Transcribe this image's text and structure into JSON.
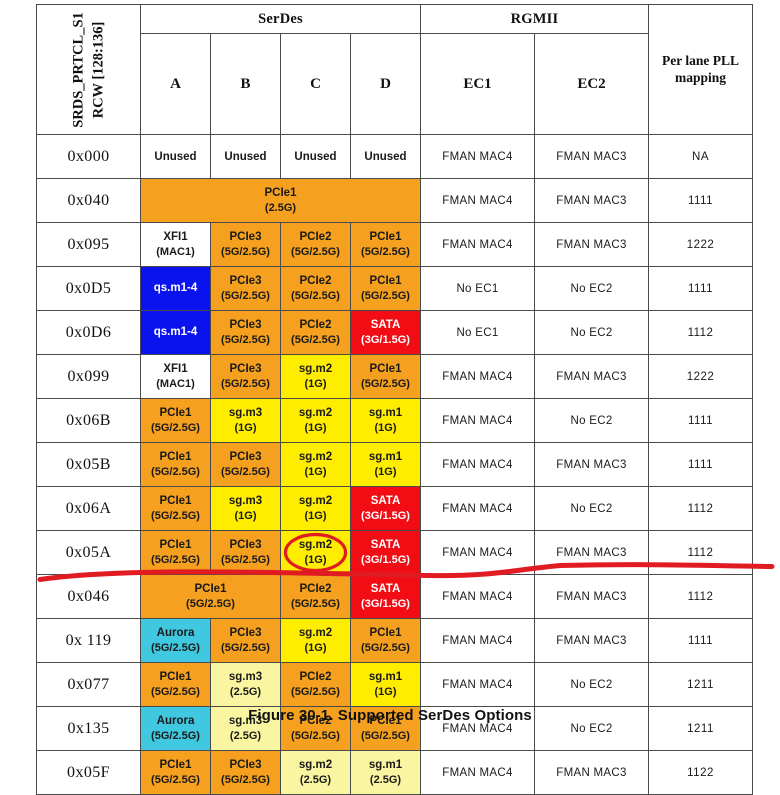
{
  "figure": {
    "caption": "Figure 30-1. Supported SerDes Options"
  },
  "table": {
    "header": {
      "rcw_label": "SRDS_PRTCL_S1\nRCW [128:136]",
      "rcw_line1": "SRDS_PRTCL_S1",
      "rcw_line2": "RCW [128:136]",
      "serdes_group": "SerDes",
      "rgmii_group": "RGMII",
      "serdes_cols": [
        "A",
        "B",
        "C",
        "D"
      ],
      "rgmii_cols": [
        "EC1",
        "EC2"
      ],
      "pll_line1": "Per lane PLL",
      "pll_line2": "mapping"
    },
    "rows": [
      {
        "code": "0x000",
        "lanes": [
          {
            "name": "Unused",
            "rate": "",
            "fill": "none",
            "span": 1,
            "style": "unused"
          },
          {
            "name": "Unused",
            "rate": "",
            "fill": "none",
            "span": 1,
            "style": "unused"
          },
          {
            "name": "Unused",
            "rate": "",
            "fill": "none",
            "span": 1,
            "style": "unused"
          },
          {
            "name": "Unused",
            "rate": "",
            "fill": "none",
            "span": 1,
            "style": "unused"
          }
        ],
        "ec1": "FMAN MAC4",
        "ec2": "FMAN MAC3",
        "pll": "NA"
      },
      {
        "code": "0x040",
        "lanes": [
          {
            "name": "PCIe1",
            "rate": "(2.5G)",
            "fill": "orange",
            "span": 4,
            "style": "cell"
          }
        ],
        "ec1": "FMAN MAC4",
        "ec2": "FMAN MAC3",
        "pll": "1111"
      },
      {
        "code": "0x095",
        "lanes": [
          {
            "name": "XFI1",
            "rate": "(MAC1)",
            "fill": "none",
            "span": 1,
            "style": "cell"
          },
          {
            "name": "PCIe3",
            "rate": "(5G/2.5G)",
            "fill": "orange",
            "span": 1,
            "style": "cell"
          },
          {
            "name": "PCIe2",
            "rate": "(5G/2.5G)",
            "fill": "orange",
            "span": 1,
            "style": "cell"
          },
          {
            "name": "PCIe1",
            "rate": "(5G/2.5G)",
            "fill": "orange",
            "span": 1,
            "style": "cell"
          }
        ],
        "ec1": "FMAN MAC4",
        "ec2": "FMAN MAC3",
        "pll": "1222"
      },
      {
        "code": "0x0D5",
        "lanes": [
          {
            "name": "qs.m1-4",
            "rate": "",
            "fill": "blue",
            "span": 1,
            "style": "cell"
          },
          {
            "name": "PCIe3",
            "rate": "(5G/2.5G)",
            "fill": "orange",
            "span": 1,
            "style": "cell"
          },
          {
            "name": "PCIe2",
            "rate": "(5G/2.5G)",
            "fill": "orange",
            "span": 1,
            "style": "cell"
          },
          {
            "name": "PCIe1",
            "rate": "(5G/2.5G)",
            "fill": "orange",
            "span": 1,
            "style": "cell"
          }
        ],
        "ec1": "No EC1",
        "ec2": "No EC2",
        "pll": "1111"
      },
      {
        "code": "0x0D6",
        "lanes": [
          {
            "name": "qs.m1-4",
            "rate": "",
            "fill": "blue",
            "span": 1,
            "style": "cell"
          },
          {
            "name": "PCIe3",
            "rate": "(5G/2.5G)",
            "fill": "orange",
            "span": 1,
            "style": "cell"
          },
          {
            "name": "PCIe2",
            "rate": "(5G/2.5G)",
            "fill": "orange",
            "span": 1,
            "style": "cell"
          },
          {
            "name": "SATA",
            "rate": "(3G/1.5G)",
            "fill": "red",
            "span": 1,
            "style": "cell"
          }
        ],
        "ec1": "No EC1",
        "ec2": "No EC2",
        "pll": "1112"
      },
      {
        "code": "0x099",
        "lanes": [
          {
            "name": "XFI1",
            "rate": "(MAC1)",
            "fill": "none",
            "span": 1,
            "style": "cell"
          },
          {
            "name": "PCIe3",
            "rate": "(5G/2.5G)",
            "fill": "orange",
            "span": 1,
            "style": "cell"
          },
          {
            "name": "sg.m2",
            "rate": "(1G)",
            "fill": "yellow",
            "span": 1,
            "style": "cell"
          },
          {
            "name": "PCIe1",
            "rate": "(5G/2.5G)",
            "fill": "orange",
            "span": 1,
            "style": "cell"
          }
        ],
        "ec1": "FMAN MAC4",
        "ec2": "FMAN MAC3",
        "pll": "1222"
      },
      {
        "code": "0x06B",
        "lanes": [
          {
            "name": "PCIe1",
            "rate": "(5G/2.5G)",
            "fill": "orange",
            "span": 1,
            "style": "cell"
          },
          {
            "name": "sg.m3",
            "rate": "(1G)",
            "fill": "yellow",
            "span": 1,
            "style": "cell"
          },
          {
            "name": "sg.m2",
            "rate": "(1G)",
            "fill": "yellow",
            "span": 1,
            "style": "cell"
          },
          {
            "name": "sg.m1",
            "rate": "(1G)",
            "fill": "yellow",
            "span": 1,
            "style": "cell"
          }
        ],
        "ec1": "FMAN MAC4",
        "ec2": "No EC2",
        "pll": "1111"
      },
      {
        "code": "0x05B",
        "lanes": [
          {
            "name": "PCIe1",
            "rate": "(5G/2.5G)",
            "fill": "orange",
            "span": 1,
            "style": "cell"
          },
          {
            "name": "PCIe3",
            "rate": "(5G/2.5G)",
            "fill": "orange",
            "span": 1,
            "style": "cell"
          },
          {
            "name": "sg.m2",
            "rate": "(1G)",
            "fill": "yellow",
            "span": 1,
            "style": "cell"
          },
          {
            "name": "sg.m1",
            "rate": "(1G)",
            "fill": "yellow",
            "span": 1,
            "style": "cell"
          }
        ],
        "ec1": "FMAN MAC4",
        "ec2": "FMAN MAC3",
        "pll": "1111"
      },
      {
        "code": "0x06A",
        "lanes": [
          {
            "name": "PCIe1",
            "rate": "(5G/2.5G)",
            "fill": "orange",
            "span": 1,
            "style": "cell"
          },
          {
            "name": "sg.m3",
            "rate": "(1G)",
            "fill": "yellow",
            "span": 1,
            "style": "cell"
          },
          {
            "name": "sg.m2",
            "rate": "(1G)",
            "fill": "yellow",
            "span": 1,
            "style": "cell"
          },
          {
            "name": "SATA",
            "rate": "(3G/1.5G)",
            "fill": "red",
            "span": 1,
            "style": "cell"
          }
        ],
        "ec1": "FMAN MAC4",
        "ec2": "No EC2",
        "pll": "1112"
      },
      {
        "code": "0x05A",
        "lanes": [
          {
            "name": "PCIe1",
            "rate": "(5G/2.5G)",
            "fill": "orange",
            "span": 1,
            "style": "cell"
          },
          {
            "name": "PCIe3",
            "rate": "(5G/2.5G)",
            "fill": "orange",
            "span": 1,
            "style": "cell"
          },
          {
            "name": "sg.m2",
            "rate": "(1G)",
            "fill": "yellow",
            "span": 1,
            "style": "cell",
            "circled": true
          },
          {
            "name": "SATA",
            "rate": "(3G/1.5G)",
            "fill": "red",
            "span": 1,
            "style": "cell"
          }
        ],
        "ec1": "FMAN MAC4",
        "ec2": "FMAN MAC3",
        "pll": "1112"
      },
      {
        "code": "0x046",
        "lanes": [
          {
            "name": "PCIe1",
            "rate": "(5G/2.5G)",
            "fill": "orange",
            "span": 2,
            "style": "cell"
          },
          {
            "name": "PCIe2",
            "rate": "(5G/2.5G)",
            "fill": "orange",
            "span": 1,
            "style": "cell"
          },
          {
            "name": "SATA",
            "rate": "(3G/1.5G)",
            "fill": "red",
            "span": 1,
            "style": "cell"
          }
        ],
        "ec1": "FMAN MAC4",
        "ec2": "FMAN MAC3",
        "pll": "1112"
      },
      {
        "code": "0x 119",
        "lanes": [
          {
            "name": "Aurora",
            "rate": "(5G/2.5G)",
            "fill": "cyan",
            "span": 1,
            "style": "cell"
          },
          {
            "name": "PCIe3",
            "rate": "(5G/2.5G)",
            "fill": "orange",
            "span": 1,
            "style": "cell"
          },
          {
            "name": "sg.m2",
            "rate": "(1G)",
            "fill": "yellow",
            "span": 1,
            "style": "cell"
          },
          {
            "name": "PCIe1",
            "rate": "(5G/2.5G)",
            "fill": "orange",
            "span": 1,
            "style": "cell"
          }
        ],
        "ec1": "FMAN MAC4",
        "ec2": "FMAN MAC3",
        "pll": "1111"
      },
      {
        "code": "0x077",
        "lanes": [
          {
            "name": "PCIe1",
            "rate": "(5G/2.5G)",
            "fill": "orange",
            "span": 1,
            "style": "cell"
          },
          {
            "name": "sg.m3",
            "rate": "(2.5G)",
            "fill": "lyellow",
            "span": 1,
            "style": "cell"
          },
          {
            "name": "PCIe2",
            "rate": "(5G/2.5G)",
            "fill": "orange",
            "span": 1,
            "style": "cell"
          },
          {
            "name": "sg.m1",
            "rate": "(1G)",
            "fill": "yellow",
            "span": 1,
            "style": "cell"
          }
        ],
        "ec1": "FMAN MAC4",
        "ec2": "No EC2",
        "pll": "1211"
      },
      {
        "code": "0x135",
        "lanes": [
          {
            "name": "Aurora",
            "rate": "(5G/2.5G)",
            "fill": "cyan",
            "span": 1,
            "style": "cell"
          },
          {
            "name": "sg.m3",
            "rate": "(2.5G)",
            "fill": "lyellow",
            "span": 1,
            "style": "cell"
          },
          {
            "name": "PCIe2",
            "rate": "(5G/2.5G)",
            "fill": "orange",
            "span": 1,
            "style": "cell"
          },
          {
            "name": "PCIe1",
            "rate": "(5G/2.5G)",
            "fill": "orange",
            "span": 1,
            "style": "cell"
          }
        ],
        "ec1": "FMAN MAC4",
        "ec2": "No EC2",
        "pll": "1211"
      },
      {
        "code": "0x05F",
        "lanes": [
          {
            "name": "PCIe1",
            "rate": "(5G/2.5G)",
            "fill": "orange",
            "span": 1,
            "style": "cell"
          },
          {
            "name": "PCIe3",
            "rate": "(5G/2.5G)",
            "fill": "orange",
            "span": 1,
            "style": "cell"
          },
          {
            "name": "sg.m2",
            "rate": "(2.5G)",
            "fill": "lyellow",
            "span": 1,
            "style": "cell"
          },
          {
            "name": "sg.m1",
            "rate": "(2.5G)",
            "fill": "lyellow",
            "span": 1,
            "style": "cell"
          }
        ],
        "ec1": "FMAN MAC4",
        "ec2": "FMAN MAC3",
        "pll": "1122"
      }
    ]
  },
  "annotations": {
    "color": "#E01B22",
    "ellipse_target": "0x05A / lane C sg.m2 (1G)",
    "line_label": "hand-drawn horizontal rule below row 0x05A"
  }
}
